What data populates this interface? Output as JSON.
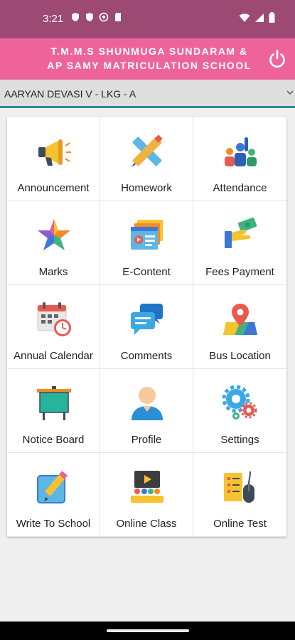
{
  "status": {
    "time": "3:21",
    "icons": [
      "shield-icon",
      "shield-icon",
      "sync-icon",
      "sd-card-icon"
    ],
    "right_icons": [
      "wifi-icon",
      "signal-icon",
      "battery-icon"
    ]
  },
  "header": {
    "school_line1": "T.M.M.S Shunmuga Sundaram &",
    "school_line2": "AP Samy Matriculation School",
    "power_icon": "power-icon"
  },
  "student": {
    "selected": "AARYAN DEVASI V - LKG - A"
  },
  "menu": [
    {
      "label": "Announcement",
      "icon": "megaphone-icon"
    },
    {
      "label": "Homework",
      "icon": "pencil-ruler-icon"
    },
    {
      "label": "Attendance",
      "icon": "people-raised-hand-icon"
    },
    {
      "label": "Marks",
      "icon": "star-icon"
    },
    {
      "label": "E-Content",
      "icon": "video-stack-icon"
    },
    {
      "label": "Fees Payment",
      "icon": "hand-money-icon"
    },
    {
      "label": "Annual Calendar",
      "icon": "calendar-clock-icon"
    },
    {
      "label": "Comments",
      "icon": "chat-bubbles-icon"
    },
    {
      "label": "Bus Location",
      "icon": "map-pin-icon"
    },
    {
      "label": "Notice Board",
      "icon": "board-icon"
    },
    {
      "label": "Profile",
      "icon": "person-icon"
    },
    {
      "label": "Settings",
      "icon": "gears-icon"
    },
    {
      "label": "Write To School",
      "icon": "write-note-icon"
    },
    {
      "label": "Online Class",
      "icon": "classroom-icon"
    },
    {
      "label": "Online Test",
      "icon": "test-mouse-icon"
    }
  ],
  "colors": {
    "statusbar": "#9c4a74",
    "appbar": "#ee649a",
    "accent_line": "#2f8b98"
  }
}
